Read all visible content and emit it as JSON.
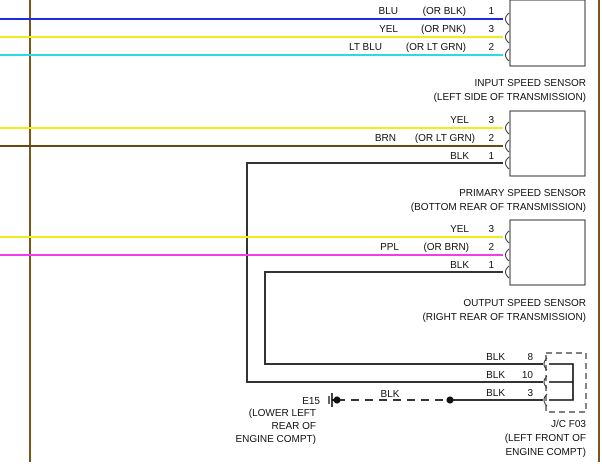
{
  "colors": {
    "blu": "#1f2bd6",
    "yel": "#f0ee18",
    "lt_blu": "#2bd9ea",
    "brn": "#6a4a12",
    "ppl": "#f23bec",
    "blk": "#333333",
    "vertical_bus": "#7a5515",
    "sensor_outline": "#333333",
    "junction_outline": "#333333"
  },
  "input_sensor": {
    "wires": [
      {
        "color_label": "BLU",
        "alt_label": "(OR BLK)",
        "pin": "1",
        "color": "blu"
      },
      {
        "color_label": "YEL",
        "alt_label": "(OR PNK)",
        "pin": "3",
        "color": "yel"
      },
      {
        "color_label": "LT BLU",
        "alt_label": "(OR LT GRN)",
        "pin": "2",
        "color": "lt_blu"
      }
    ],
    "name": "INPUT SPEED SENSOR",
    "location": "(LEFT SIDE OF TRANSMISSION)"
  },
  "primary_sensor": {
    "wires": [
      {
        "color_label": "YEL",
        "alt_label": "",
        "pin": "3",
        "color": "yel"
      },
      {
        "color_label": "BRN",
        "alt_label": "(OR LT GRN)",
        "pin": "2",
        "color": "brn"
      },
      {
        "color_label": "BLK",
        "alt_label": "",
        "pin": "1",
        "color": "blk"
      }
    ],
    "name": "PRIMARY SPEED SENSOR",
    "location": "(BOTTOM REAR OF TRANSMISSION)"
  },
  "output_sensor": {
    "wires": [
      {
        "color_label": "YEL",
        "alt_label": "",
        "pin": "3",
        "color": "yel"
      },
      {
        "color_label": "PPL",
        "alt_label": "(OR BRN)",
        "pin": "2",
        "color": "ppl"
      },
      {
        "color_label": "BLK",
        "alt_label": "",
        "pin": "1",
        "color": "blk"
      }
    ],
    "name": "OUTPUT SPEED SENSOR",
    "location": "(RIGHT REAR OF TRANSMISSION)"
  },
  "junction": {
    "wires": [
      {
        "color_label": "BLK",
        "pin": "8"
      },
      {
        "color_label": "BLK",
        "pin": "10"
      },
      {
        "color_label": "BLK",
        "pin": "3"
      }
    ],
    "name": "J/C F03",
    "location_line1": "(LEFT FRONT OF",
    "location_line2": "ENGINE COMPT)"
  },
  "ground": {
    "id": "E15",
    "location_line1": "(LOWER LEFT",
    "location_line2": "REAR OF",
    "location_line3": "ENGINE COMPT)",
    "wire_label": "BLK"
  }
}
